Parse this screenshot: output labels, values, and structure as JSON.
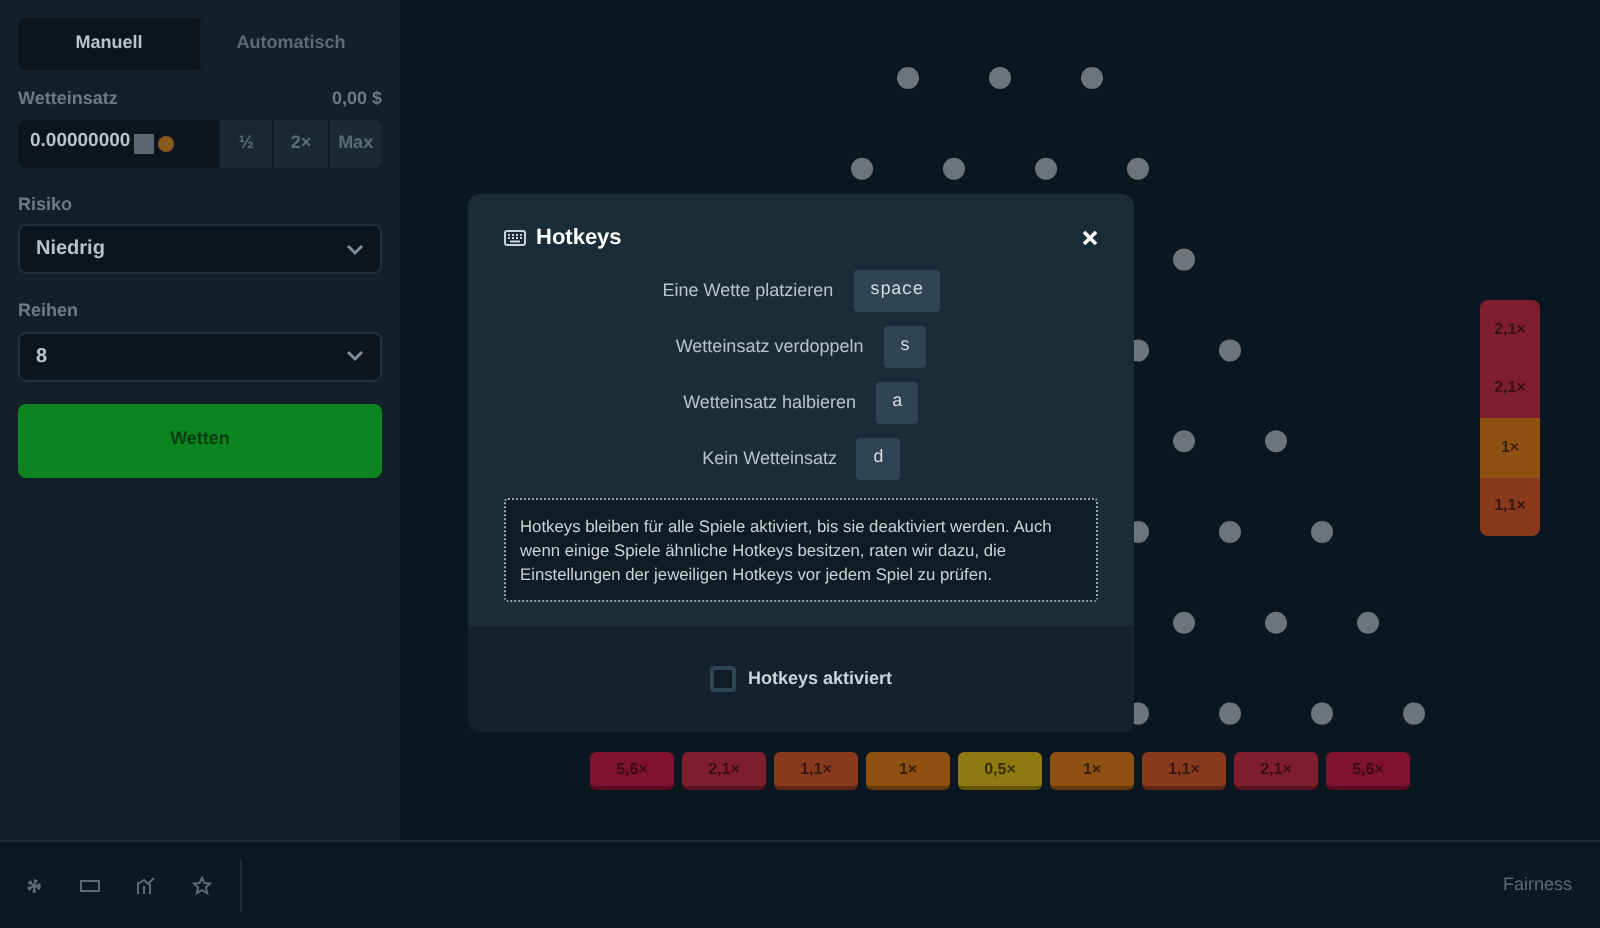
{
  "sidebar": {
    "tabs": [
      {
        "label": "Manuell",
        "selected": true
      },
      {
        "label": "Automatisch",
        "selected": false
      }
    ],
    "bet": {
      "label": "Wetteinsatz",
      "amount": "0,00 $",
      "value": "0.00000000",
      "buttons": [
        "½",
        "2×",
        "Max"
      ]
    },
    "risk": {
      "label": "Risiko",
      "value": "Niedrig"
    },
    "rows": {
      "label": "Reihen",
      "value": "8"
    },
    "bet_button": "Wetten"
  },
  "board": {
    "multipliers": [
      {
        "label": "5,6×",
        "color": "#7e1230"
      },
      {
        "label": "2,1×",
        "color": "#7e1e2c"
      },
      {
        "label": "1,1×",
        "color": "#8a3a1c"
      },
      {
        "label": "1×",
        "color": "#8e5112"
      },
      {
        "label": "0,5×",
        "color": "#8e7a10"
      },
      {
        "label": "1×",
        "color": "#8e5112"
      },
      {
        "label": "1,1×",
        "color": "#8a3a1c"
      },
      {
        "label": "2,1×",
        "color": "#7e1e2c"
      },
      {
        "label": "5,6×",
        "color": "#7e1230"
      }
    ],
    "history": [
      {
        "label": "2,1×",
        "color": "#7e1e2c"
      },
      {
        "label": "2,1×",
        "color": "#7e1e2c"
      },
      {
        "label": "1×",
        "color": "#8e5112"
      },
      {
        "label": "1,1×",
        "color": "#8a3a1c"
      }
    ]
  },
  "modal": {
    "title": "Hotkeys",
    "hotkeys": [
      {
        "action": "Eine Wette platzieren",
        "key": "space"
      },
      {
        "action": "Wetteinsatz verdoppeln",
        "key": "s"
      },
      {
        "action": "Wetteinsatz halbieren",
        "key": "a"
      },
      {
        "action": "Kein Wetteinsatz",
        "key": "d"
      }
    ],
    "note": "Hotkeys bleiben für alle Spiele aktiviert, bis sie deaktiviert werden. Auch wenn einige Spiele ähnliche Hotkeys besitzen, raten wir dazu, die Einstellungen der jeweiligen Hotkeys vor jedem Spiel zu prüfen.",
    "checkbox": {
      "label": "Hotkeys aktiviert",
      "checked": false
    }
  },
  "footer": {
    "link": "Fairness"
  }
}
